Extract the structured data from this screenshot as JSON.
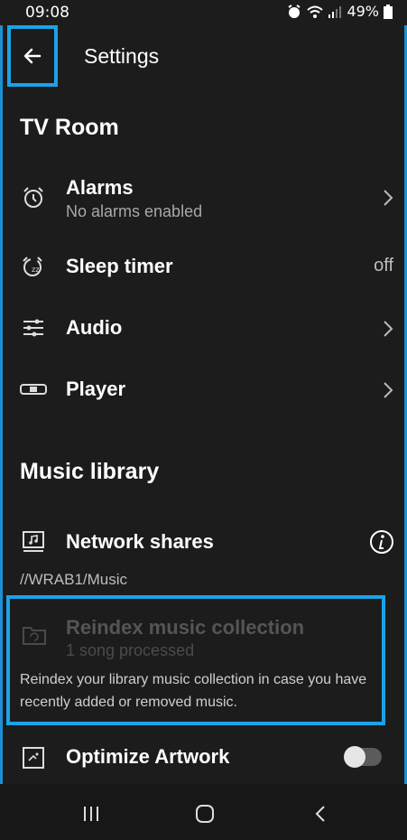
{
  "status_bar": {
    "time": "09:08",
    "battery": "49%"
  },
  "app_bar": {
    "title": "Settings"
  },
  "room": {
    "name": "TV Room",
    "items": [
      {
        "label": "Alarms",
        "sub": "No alarms enabled"
      },
      {
        "label": "Sleep timer",
        "value": "off"
      },
      {
        "label": "Audio"
      },
      {
        "label": "Player"
      }
    ]
  },
  "music_library": {
    "header": "Music library",
    "network_shares": {
      "label": "Network shares",
      "path": "//WRAB1/Music"
    },
    "reindex": {
      "label": "Reindex music collection",
      "sub": "1 song processed",
      "description": "Reindex your library music collection in case you have recently added or removed music."
    },
    "optimize_artwork": {
      "label": "Optimize Artwork",
      "enabled": false
    }
  },
  "icons": {
    "back": "arrow-left-icon",
    "alarm": "alarm-clock-icon",
    "sleep": "sleep-timer-icon",
    "audio": "sliders-icon",
    "player": "player-icon",
    "network": "folder-music-icon",
    "info": "info-icon",
    "reindex": "folder-refresh-icon",
    "artwork": "artwork-icon"
  },
  "colors": {
    "accent": "#1aa3e8",
    "background": "#1c1c1c"
  }
}
